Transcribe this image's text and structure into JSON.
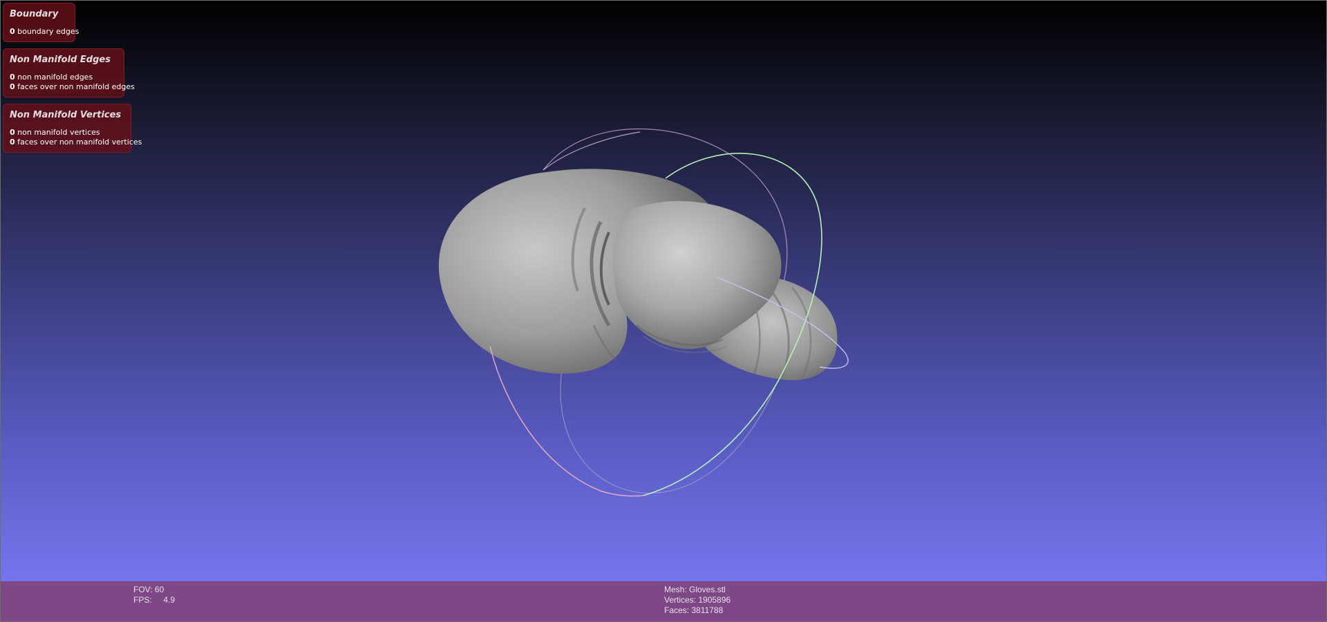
{
  "panels": {
    "boundary": {
      "title": "Boundary",
      "lines": [
        {
          "count": "0",
          "text": "boundary edges"
        }
      ]
    },
    "non_manifold_edges": {
      "title": "Non Manifold Edges",
      "lines": [
        {
          "count": "0",
          "text": "non manifold edges"
        },
        {
          "count": "0",
          "text": "faces over non manifold edges"
        }
      ]
    },
    "non_manifold_vertices": {
      "title": "Non Manifold Vertices",
      "lines": [
        {
          "count": "0",
          "text": "non manifold vertices"
        },
        {
          "count": "0",
          "text": "faces over non manifold vertices"
        }
      ]
    }
  },
  "status": {
    "fov": "FOV: 60",
    "fps": "FPS:     4.9",
    "mesh": "Mesh: Gloves.stl",
    "vertices": "Vertices: 1905896",
    "faces": "Faces: 3811788"
  },
  "scene": {
    "model": "boxing-glove-mesh",
    "trackball": "trackball-rings"
  },
  "colors": {
    "panel_bg": "#641018",
    "status_bar_bg": "#7e4786",
    "gradient_top": "#000000",
    "gradient_bottom": "#7677ee",
    "mesh_gray": "#8a8a8a",
    "ring_green": "#b6f2b8",
    "ring_pink": "#e7a8c3",
    "ring_violet": "#c7c0f2"
  }
}
